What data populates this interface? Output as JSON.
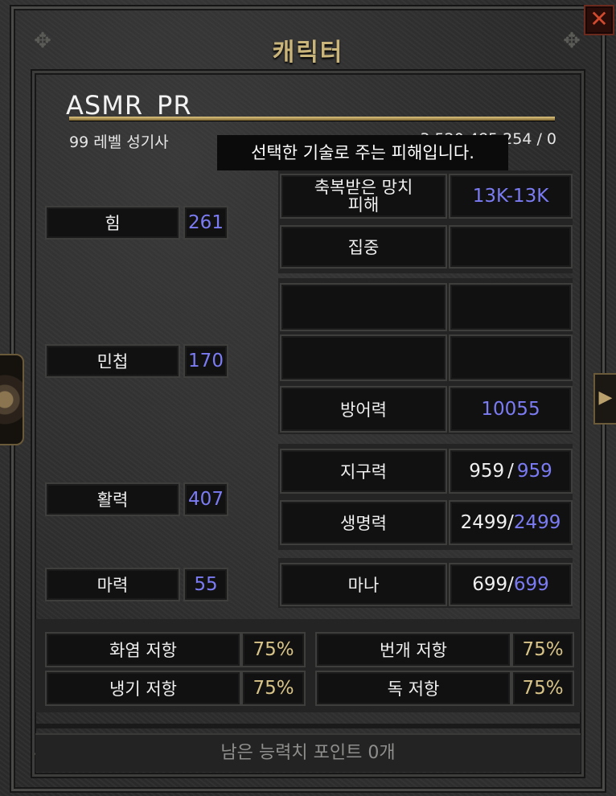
{
  "window": {
    "title": "캐릭터",
    "close_label": "✕"
  },
  "character": {
    "name": "ASMR_PR",
    "class_line": "99 레벨 성기사",
    "experience": "3,520,485,254 / 0"
  },
  "tooltip": "선택한 기술로 주는 피해입니다.",
  "attributes": [
    {
      "label": "힘",
      "value": "261"
    },
    {
      "label": "민첩",
      "value": "170"
    },
    {
      "label": "활력",
      "value": "407"
    },
    {
      "label": "마력",
      "value": "55"
    }
  ],
  "combat": {
    "damage_label": "축복받은 망치\n피해",
    "damage_value": "13K-13K",
    "focus_label": "집중",
    "focus_value": "",
    "defense_label": "방어력",
    "defense_value": "10055"
  },
  "pools": [
    {
      "label": "지구력",
      "current": "959",
      "sep": "/",
      "max": "959"
    },
    {
      "label": "생명력",
      "current": "2499",
      "sep": "/",
      "max": "2499"
    },
    {
      "label": "마나",
      "current": "699",
      "sep": "/",
      "max": "699"
    }
  ],
  "resistances": [
    {
      "label": "화염 저항",
      "value": "75%"
    },
    {
      "label": "번개 저항",
      "value": "75%"
    },
    {
      "label": "냉기 저항",
      "value": "75%"
    },
    {
      "label": "독 저항",
      "value": "75%"
    }
  ],
  "footer": "남은 능력치 포인트 0개",
  "icons": {
    "close": "close-icon",
    "expand": "arrow-right-icon",
    "ornament": "ornament-icon"
  }
}
